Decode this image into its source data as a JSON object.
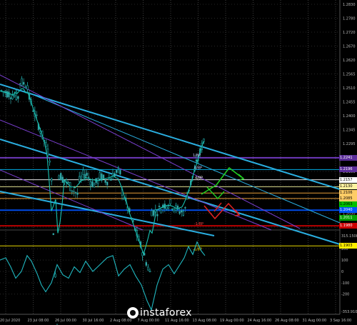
{
  "chart": {
    "price_axis": [
      "1.2830",
      "1.2780",
      "1.2720",
      "1.2670",
      "1.2620",
      "1.2565",
      "1.2510",
      "1.2455",
      "1.2400",
      "1.2345",
      "1.2295",
      "1.2240",
      "1.2190",
      "1.2135",
      "1.2080",
      "1.2030",
      "1.1975"
    ],
    "price_labels": [
      {
        "text": "1.2241",
        "bg": "#5b2d99"
      },
      {
        "text": "1.2196",
        "bg": "#5b2d99"
      },
      {
        "text": "1.2157",
        "bg": "#ffffff"
      },
      {
        "text": "1.2130",
        "bg": "#fff2a0"
      },
      {
        "text": "1.2106",
        "bg": "#ffcc66"
      },
      {
        "text": "1.2085",
        "bg": "#ffcc66"
      },
      {
        "text": "1.2063",
        "bg": "#00c000"
      },
      {
        "text": "1.2040",
        "bg": "#0055ff"
      },
      {
        "text": "1.2011",
        "bg": "#00a000"
      },
      {
        "text": "1.1980",
        "bg": "#cc0000"
      },
      {
        "text": "1.1903",
        "bg": "#ffee00"
      }
    ],
    "level_labels": [
      {
        "text": "1/8P",
        "color": "#ccccff"
      },
      {
        "text": "0/8P",
        "color": "#ccccff"
      },
      {
        "text": "4/8P",
        "color": "#ffffff"
      },
      {
        "text": "-1/8P",
        "color": "#ff4444"
      },
      {
        "text": "-1/8P",
        "color": "#ffee00"
      }
    ],
    "indicator_axis": [
      "315.1508",
      "200",
      "100",
      "0",
      "-100",
      "-200",
      "-353.910"
    ],
    "dates": [
      "20 Jul 2020",
      "23 Jul 08:00",
      "26 Jul 00:00",
      "30 Jul 16:00",
      "2 Aug 08:00",
      "7 Aug 00:00",
      "11 Aug 16:00",
      "13 Aug 08:00",
      "19 Aug 00:00",
      "24 Aug 16:00",
      "26 Aug 08:00",
      "31 Aug 00:00",
      "3 Sep 16:00"
    ]
  },
  "watermark": {
    "brand": "instaforex",
    "logo_icon": "instaforex-logo-icon"
  }
}
